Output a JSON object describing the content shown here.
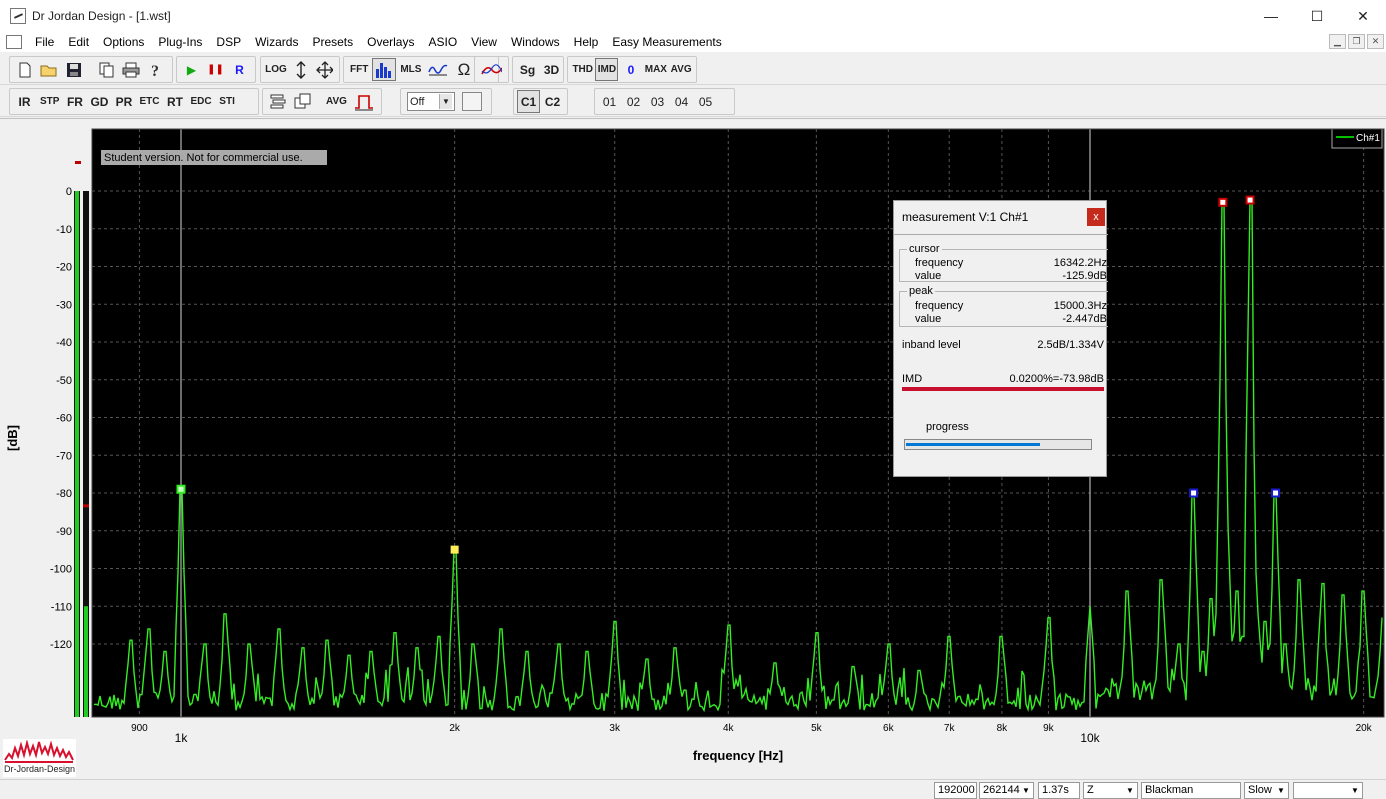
{
  "window": {
    "title": "Dr Jordan Design - [1.wst]",
    "minimize": "—",
    "maximize": "☐",
    "close": "✕"
  },
  "menu": [
    "File",
    "Edit",
    "Options",
    "Plug-Ins",
    "DSP",
    "Wizards",
    "Presets",
    "Overlays",
    "ASIO",
    "View",
    "Windows",
    "Help",
    "Easy Measurements"
  ],
  "mdi": {
    "min": "▁",
    "restore": "❐",
    "close": "✕"
  },
  "toolbar1": {
    "log": "LOG",
    "fft": "FFT",
    "mls": "MLS",
    "sg": "Sg",
    "threed": "3D",
    "thd": "THD",
    "imd": "IMD",
    "zero": "0",
    "max": "MAX",
    "avg": "AVG",
    "play": "▶",
    "pause": "❚❚",
    "rec": "R",
    "omega": "Ω"
  },
  "toolbar2": {
    "buttons": [
      "IR",
      "STP",
      "FR",
      "GD",
      "PR",
      "ETC",
      "RT",
      "EDC",
      "STI"
    ],
    "avg": "AVG",
    "select_value": "Off",
    "channels": [
      "C1",
      "C2"
    ],
    "overlays": [
      "01",
      "02",
      "03",
      "04",
      "05"
    ]
  },
  "chart_data": {
    "type": "line",
    "xlabel": "frequency [Hz]",
    "ylabel": "[dB]",
    "x_scale": "log",
    "xlim": [
      800,
      21000
    ],
    "ylim": [
      -140,
      0
    ],
    "y_ticks": [
      0,
      -10,
      -20,
      -30,
      -40,
      -50,
      -60,
      -70,
      -80,
      -90,
      -100,
      -110,
      -120
    ],
    "x_ticks": [
      {
        "value": 900,
        "label": "900",
        "major": false
      },
      {
        "value": 1000,
        "label": "1k",
        "major": true
      },
      {
        "value": 2000,
        "label": "2k",
        "major": false
      },
      {
        "value": 3000,
        "label": "3k",
        "major": false
      },
      {
        "value": 4000,
        "label": "4k",
        "major": false
      },
      {
        "value": 5000,
        "label": "5k",
        "major": false
      },
      {
        "value": 6000,
        "label": "6k",
        "major": false
      },
      {
        "value": 7000,
        "label": "7k",
        "major": false
      },
      {
        "value": 8000,
        "label": "8k",
        "major": false
      },
      {
        "value": 9000,
        "label": "9k",
        "major": false
      },
      {
        "value": 10000,
        "label": "10k",
        "major": true
      },
      {
        "value": 20000,
        "label": "20k",
        "major": false
      }
    ],
    "watermark": "Student version. Not for commercial use.",
    "legend": {
      "label": "Ch#1",
      "placement": "top-right",
      "color": "#00ff00"
    },
    "grid": true,
    "series": [
      {
        "name": "Ch#1",
        "color": "#33ee22",
        "noise_floor": -134,
        "peaks": [
          {
            "f": 880,
            "db": -119
          },
          {
            "f": 920,
            "db": -116
          },
          {
            "f": 960,
            "db": -122
          },
          {
            "f": 1000,
            "db": -79
          },
          {
            "f": 1060,
            "db": -120
          },
          {
            "f": 1120,
            "db": -112
          },
          {
            "f": 1190,
            "db": -120
          },
          {
            "f": 1280,
            "db": -116
          },
          {
            "f": 1360,
            "db": -121
          },
          {
            "f": 1450,
            "db": -119
          },
          {
            "f": 1530,
            "db": -123
          },
          {
            "f": 1620,
            "db": -122
          },
          {
            "f": 1720,
            "db": -117
          },
          {
            "f": 1820,
            "db": -121
          },
          {
            "f": 1920,
            "db": -118
          },
          {
            "f": 2000,
            "db": -95
          },
          {
            "f": 2100,
            "db": -120
          },
          {
            "f": 2250,
            "db": -116
          },
          {
            "f": 2400,
            "db": -122
          },
          {
            "f": 2600,
            "db": -120
          },
          {
            "f": 2800,
            "db": -122
          },
          {
            "f": 3000,
            "db": -114
          },
          {
            "f": 3250,
            "db": -124
          },
          {
            "f": 3500,
            "db": -121
          },
          {
            "f": 4000,
            "db": -115
          },
          {
            "f": 4500,
            "db": -125
          },
          {
            "f": 5000,
            "db": -117
          },
          {
            "f": 5500,
            "db": -126
          },
          {
            "f": 6000,
            "db": -120
          },
          {
            "f": 6500,
            "db": -127
          },
          {
            "f": 7000,
            "db": -118
          },
          {
            "f": 8000,
            "db": -118
          },
          {
            "f": 9000,
            "db": -113
          },
          {
            "f": 10000,
            "db": -110
          },
          {
            "f": 11000,
            "db": -106
          },
          {
            "f": 12000,
            "db": -103
          },
          {
            "f": 12500,
            "db": -120
          },
          {
            "f": 13000,
            "db": -80
          },
          {
            "f": 13300,
            "db": -122
          },
          {
            "f": 13600,
            "db": -108
          },
          {
            "f": 13800,
            "db": -112
          },
          {
            "f": 14000,
            "db": -3
          },
          {
            "f": 14200,
            "db": -104
          },
          {
            "f": 14500,
            "db": -106
          },
          {
            "f": 14700,
            "db": -118
          },
          {
            "f": 15000,
            "db": -2.4
          },
          {
            "f": 15300,
            "db": -112
          },
          {
            "f": 15600,
            "db": -114
          },
          {
            "f": 16000,
            "db": -80
          },
          {
            "f": 16400,
            "db": -120
          },
          {
            "f": 17000,
            "db": -103
          },
          {
            "f": 18000,
            "db": -104
          },
          {
            "f": 19000,
            "db": -107
          },
          {
            "f": 20000,
            "db": -106
          },
          {
            "f": 21000,
            "db": -113
          }
        ]
      }
    ],
    "markers": [
      {
        "f": 1000,
        "db": -79,
        "kind": "harmonic"
      },
      {
        "f": 2000,
        "db": -95,
        "kind": "harmonic-yellow"
      },
      {
        "f": 13000,
        "db": -80,
        "kind": "imd-product"
      },
      {
        "f": 14000,
        "db": -3,
        "kind": "tone"
      },
      {
        "f": 15000,
        "db": -2.4,
        "kind": "tone"
      },
      {
        "f": 16000,
        "db": -80,
        "kind": "imd-product"
      }
    ],
    "cursors": [
      1000,
      10000
    ],
    "level_meters": {
      "left_db": -122,
      "right_db": -110,
      "peak_hold_db": -83
    }
  },
  "measurement": {
    "title": "measurement V:1 Ch#1",
    "close": "x",
    "cursor": {
      "legend": "cursor",
      "frequency_label": "frequency",
      "frequency": "16342.2Hz",
      "value_label": "value",
      "value": "-125.9dB"
    },
    "peak": {
      "legend": "peak",
      "frequency_label": "frequency",
      "frequency": "15000.3Hz",
      "value_label": "value",
      "value": "-2.447dB"
    },
    "inband_label": "inband level",
    "inband_value": "2.5dB/1.334V",
    "imd_label": "IMD",
    "imd_value": "0.0200%=-73.98dB",
    "progress_label": "progress",
    "progress": 0.72
  },
  "logo_text": "Dr-Jordan-Design",
  "status": {
    "sample_rate": "192000",
    "fft_size": "262144",
    "duration": "1.37s",
    "weighting": "Z",
    "window_fn": "Blackman",
    "speed": "Slow",
    "extra": ""
  },
  "colors": {
    "plot_bg": "#000000",
    "trace": "#33ee22",
    "grid": "#555555",
    "accent_red": "#c8102e",
    "progress": "#0078d4"
  }
}
